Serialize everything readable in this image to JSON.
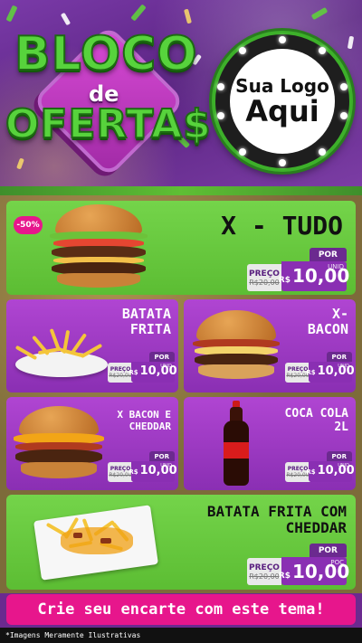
{
  "header": {
    "brand_top": "BLOCO",
    "brand_de": "de",
    "brand_bottom": "OFERTA$",
    "logo_line1": "Sua Logo",
    "logo_line2": "Aqui"
  },
  "colors": {
    "green": "#5cbd33",
    "purple": "#8a2fb3",
    "pink": "#e7168c"
  },
  "products": [
    {
      "name": "X - TUDO",
      "badge": "-50%",
      "por": "POR",
      "preco_label": "PREÇO",
      "old_price": "R$20,00",
      "currency": "R$",
      "price": "10,00",
      "unit": "UNID",
      "icon": "burger-icon"
    },
    {
      "name": "BATATA FRITA",
      "por": "POR",
      "preco_label": "PREÇO",
      "old_price": "R$20,00",
      "currency": "R$",
      "price": "10,00",
      "unit": "UNID",
      "icon": "fries-icon"
    },
    {
      "name": "X- BACON",
      "por": "POR",
      "preco_label": "PREÇO",
      "old_price": "R$20,00",
      "currency": "R$",
      "price": "10,00",
      "unit": "UNID",
      "icon": "bacon-burger-icon"
    },
    {
      "name": "X BACON E CHEDDAR",
      "por": "POR",
      "preco_label": "PREÇO",
      "old_price": "R$20,00",
      "currency": "R$",
      "price": "10,00",
      "unit": "UNID",
      "icon": "cheddar-burger-icon"
    },
    {
      "name": "COCA COLA 2L",
      "por": "POR",
      "preco_label": "PREÇO",
      "old_price": "R$20,00",
      "currency": "R$",
      "price": "10,00",
      "unit": "UNID",
      "icon": "soda-bottle-icon"
    },
    {
      "name": "BATATA FRITA COM CHEDDAR",
      "por": "POR",
      "preco_label": "PREÇO",
      "old_price": "R$20,00",
      "currency": "R$",
      "price": "10,00",
      "unit": "POÇ",
      "icon": "cheddar-fries-icon"
    }
  ],
  "footer": {
    "cta": "Crie seu encarte com este tema!",
    "disclaimer": "*Imagens Meramente Ilustrativas"
  }
}
